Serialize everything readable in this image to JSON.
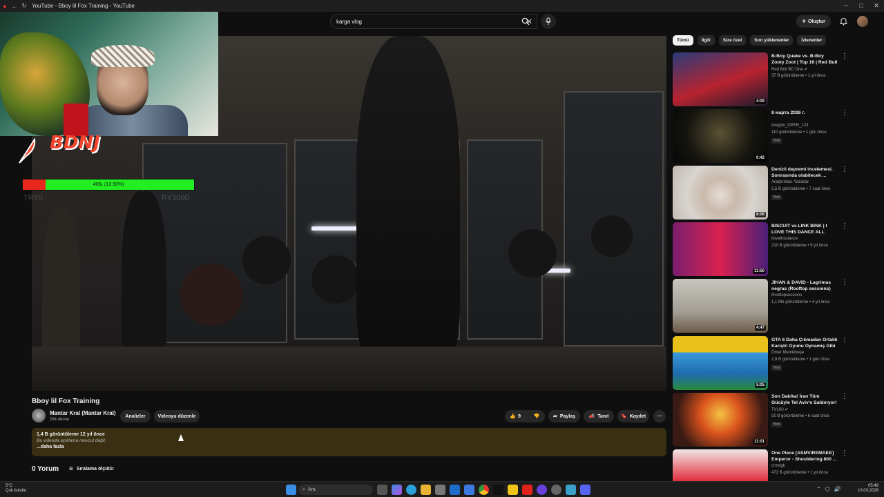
{
  "window": {
    "title": "YouTube - Bboy lil Fox Training - YouTube"
  },
  "search": {
    "query": "karga vlog"
  },
  "header": {
    "create_label": "Oluştur"
  },
  "overlay": {
    "hp_text": "405ʟ (13.50%)",
    "hp_fraction": 0.135,
    "left_label": "TRY0",
    "right_label": "RY3000",
    "logo_text": "BDNJ"
  },
  "video": {
    "title": "Bboy lil Fox Training",
    "channel_name": "Mantar Kral (Mantar Kral)",
    "subscribers": "294 abone",
    "analytics_label": "Analizler",
    "edit_label": "Videoyu düzenle",
    "likes": "9",
    "share_label": "Paylaş",
    "promote_label": "Tanıt",
    "save_label": "Kaydet",
    "meta": "1,4 B görüntüleme  12 yıl önce",
    "description": "Bu videoda açıklama mevcut değil.",
    "more_label": "...daha fazla",
    "comments_label": "0 Yorum",
    "sort_label": "Sıralama ölçütü:"
  },
  "chips": [
    "Tümü",
    "İlgili",
    "Size özel",
    "Son yüklenenler",
    "İzlenenler"
  ],
  "recommendations": [
    {
      "title": "B-Boy Quake vs. B-Boy Zooty Zoot | Top 16 | Red Bull BC O...",
      "channel": "Red Bull BC One ✔",
      "meta": "37 B görüntüleme • 1 yıl önce",
      "duration": "4:09",
      "new": ""
    },
    {
      "title": "8 марта 2026 г.",
      "channel": "ibragim_OPER_123",
      "meta": "110 görüntüleme • 1 gün önce",
      "duration": "0:42",
      "new": "Yeni"
    },
    {
      "title": "Denizli depremi incelemesi. Sonrasında olabilecek ...",
      "channel": "Araştırmacı Yazarlar",
      "meta": "5,5 B görüntüleme • 7 saat önce",
      "duration": "8:08",
      "new": "Yeni"
    },
    {
      "title": "BISCUIT vs LINK BINK | I LOVE THIS DANCE ALL STAR GAM...",
      "channel": "ilovethisdance",
      "meta": "210 B görüntüleme • 9 yıl önce",
      "duration": "11:50",
      "new": ""
    },
    {
      "title": "JIHAN & DAVID - Lagrimas negras (Rooftop sessions)",
      "channel": "Rooftopsessions",
      "meta": "1,1 Mn görüntüleme • 4 yıl önce",
      "duration": "4:47",
      "new": ""
    },
    {
      "title": "GTA 6 Daha Çıkmadan Ortalık Karıştı! Oyunu Oynamış Gibi ...",
      "channel": "Ömer Memikbeşe",
      "meta": "2,9 B görüntüleme • 1 gün önce",
      "duration": "5:05",
      "new": "Yeni"
    },
    {
      "title": "Son Dakika! İran Tüm Gücüyle Tel Aviv'e Saldırıyor! | Eşit ...",
      "channel": "TV100 ✔",
      "meta": "50 B görüntüleme • 6 saat önce",
      "duration": "11:01",
      "new": "Yeni"
    },
    {
      "title": "One Piece [ASMV/REMAKE] Emperor - Shouldering 800 ...",
      "channel": "crmdgk",
      "meta": "472 B görüntüleme • 1 yıl önce",
      "duration": "",
      "new": ""
    }
  ],
  "taskbar": {
    "weather_temp": "5°C",
    "weather_desc": "Çok bulutlu",
    "search_placeholder": "Ara",
    "time": "05:49",
    "date": "10.03.2026"
  }
}
